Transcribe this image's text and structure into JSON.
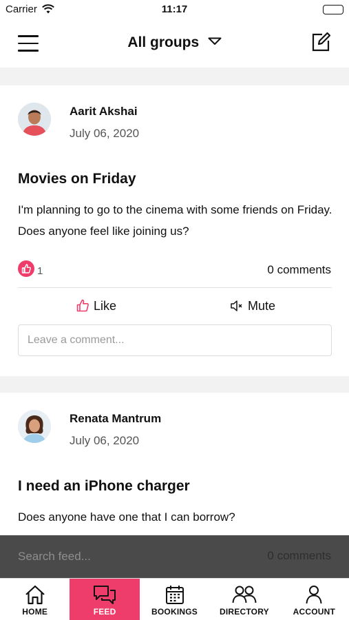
{
  "status_bar": {
    "carrier": "Carrier",
    "time": "11:17"
  },
  "nav": {
    "title": "All groups",
    "menu_icon": "hamburger-menu-icon",
    "compose_icon": "compose-edit-icon"
  },
  "posts": [
    {
      "author": "Aarit Akshai",
      "date": "July 06, 2020",
      "title": "Movies on Friday",
      "body": "I'm planning to go to the cinema with some friends on Friday. Does anyone feel like joining us?",
      "likes": "1",
      "comments": "0 comments",
      "like_label": "Like",
      "mute_label": "Mute",
      "comment_placeholder": "Leave a comment..."
    },
    {
      "author": "Renata Mantrum",
      "date": "July 06, 2020",
      "title": "I need an iPhone charger",
      "body": "Does anyone have one that I can borrow?",
      "comments": "0 comments"
    }
  ],
  "search": {
    "placeholder": "Search feed..."
  },
  "tabs": [
    {
      "label": "HOME",
      "icon": "home-icon",
      "active": false
    },
    {
      "label": "FEED",
      "icon": "chat-bubbles-icon",
      "active": true
    },
    {
      "label": "BOOKINGS",
      "icon": "calendar-icon",
      "active": false
    },
    {
      "label": "DIRECTORY",
      "icon": "people-icon",
      "active": false
    },
    {
      "label": "ACCOUNT",
      "icon": "person-icon",
      "active": false
    }
  ],
  "colors": {
    "accent": "#ef3d6b",
    "search_bar": "#4a4a4a",
    "separator": "#f2f2f2"
  }
}
